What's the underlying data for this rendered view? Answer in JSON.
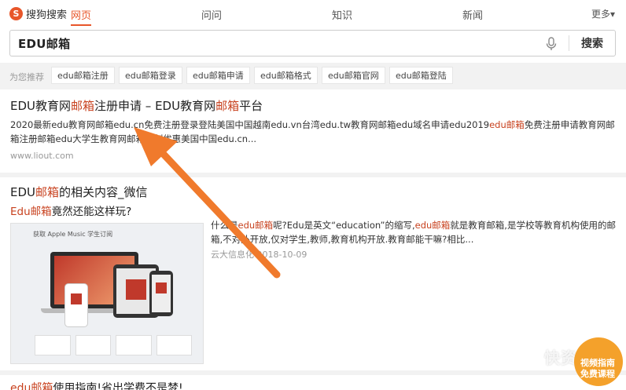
{
  "nav": {
    "logo_text": "搜狗搜索",
    "tabs": [
      {
        "label": "网页",
        "active": true
      },
      {
        "label": "问问"
      },
      {
        "label": "知识"
      },
      {
        "label": "新闻"
      }
    ],
    "more": "更多▾"
  },
  "search": {
    "query": "EDU邮箱",
    "button": "搜索"
  },
  "suggestions": {
    "label": "为您推荐",
    "items": [
      "edu邮箱注册",
      "edu邮箱登录",
      "edu邮箱申请",
      "edu邮箱格式",
      "edu邮箱官网",
      "edu邮箱登陆"
    ]
  },
  "result1": {
    "title_a": "EDU教育网",
    "title_hl1": "邮箱",
    "title_b": "注册申请 – EDU教育网",
    "title_hl2": "邮箱",
    "title_c": "平台",
    "snippet_a": "2020最新edu教育网邮箱edu.cn免费注册登录登陆美国中国越南edu.vn台湾edu.tw教育网邮箱edu域名申请edu2019",
    "snippet_hl": "edu邮箱",
    "snippet_b": "免费注册申请教育网邮箱注册邮箱edu大学生教育网邮箱定制优惠美国中国edu.cn...",
    "url": "www.liout.com"
  },
  "result2": {
    "title_a": "EDU",
    "title_hl": "邮箱",
    "title_b": "的相关内容_微信",
    "sub_hl": "Edu邮箱",
    "sub_b": "竟然还能这样玩?",
    "thumb_caption": "获取 Apple Music 学生订阅",
    "text_a": "什么是",
    "text_hl1": "edu邮箱",
    "text_b": "呢?Edu是英文“education”的缩写,",
    "text_hl2": "edu邮箱",
    "text_c": "就是教育邮箱,是学校等教育机构使用的邮箱,不对外开放,仅对学生,教师,教育机构开放.教育邮能干嘛?相比...",
    "meta_source": "云大信息化",
    "meta_date": "2018-10-09"
  },
  "result3": {
    "title_hl": "edu邮箱",
    "title_b": "使用指南!省出学费不是梦!"
  },
  "watermark": {
    "text": "快资讯",
    "badge_line1": "视频指南",
    "badge_line2": "免费课程"
  },
  "colors": {
    "accent": "#e8562a",
    "highlight": "#c8421f",
    "arrow": "#f07a2c"
  }
}
